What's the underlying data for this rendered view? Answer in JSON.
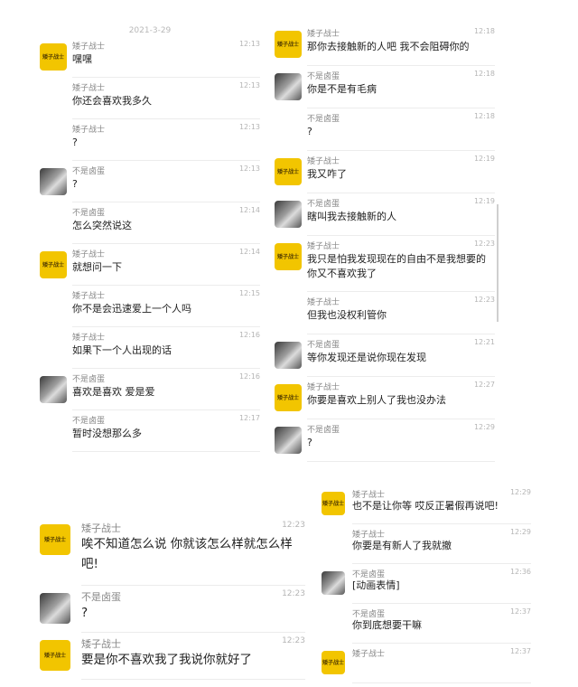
{
  "date_separator": "2021-3-29",
  "sender_a": "矮子战士",
  "sender_b": "不是卤蛋",
  "panel_tl": [
    {
      "who": "a",
      "avatar": "yellow-avatar",
      "time": "12:13",
      "text": "嘿嘿"
    },
    {
      "who": "a",
      "avatar": "",
      "time": "12:13",
      "text": "你还会喜欢我多久"
    },
    {
      "who": "a",
      "avatar": "",
      "time": "12:13",
      "text": "?"
    },
    {
      "who": "b",
      "avatar": "photo-avatar",
      "time": "12:13",
      "text": "?"
    },
    {
      "who": "b",
      "avatar": "",
      "time": "12:14",
      "text": "怎么突然说这"
    },
    {
      "who": "a",
      "avatar": "yellow-avatar",
      "time": "12:14",
      "text": "就想问一下"
    },
    {
      "who": "a",
      "avatar": "",
      "time": "12:15",
      "text": "你不是会迅速爱上一个人吗"
    },
    {
      "who": "a",
      "avatar": "",
      "time": "12:16",
      "text": "如果下一个人出现的话"
    },
    {
      "who": "b",
      "avatar": "photo-avatar",
      "time": "12:16",
      "text": "喜欢是喜欢 爱是爱"
    },
    {
      "who": "b",
      "avatar": "",
      "time": "12:17",
      "text": "暂时没想那么多"
    }
  ],
  "panel_tr": [
    {
      "who": "a",
      "avatar": "yellow-avatar",
      "time": "12:18",
      "text": "那你去接触新的人吧 我不会阻碍你的"
    },
    {
      "who": "b",
      "avatar": "photo-avatar",
      "time": "12:18",
      "text": "你是不是有毛病"
    },
    {
      "who": "b",
      "avatar": "",
      "time": "12:18",
      "text": "?"
    },
    {
      "who": "a",
      "avatar": "yellow-avatar",
      "time": "12:19",
      "text": "我又咋了"
    },
    {
      "who": "b",
      "avatar": "photo-avatar",
      "time": "12:19",
      "text": "瞎叫我去接触新的人"
    },
    {
      "who": "a",
      "avatar": "yellow-avatar",
      "time": "12:23",
      "text": "我只是怕我发现现在的自由不是我想要的 你又不喜欢我了"
    },
    {
      "who": "a",
      "avatar": "",
      "time": "12:23",
      "text": "但我也没权利管你"
    },
    {
      "who": "b",
      "avatar": "photo-avatar",
      "time": "12:21",
      "text": "等你发现还是说你现在发现"
    },
    {
      "who": "a",
      "avatar": "yellow-avatar",
      "time": "12:27",
      "text": "你要是喜欢上别人了我也没办法"
    },
    {
      "who": "b",
      "avatar": "photo-avatar",
      "time": "12:29",
      "text": "?"
    }
  ],
  "panel_bl": [
    {
      "who": "a",
      "avatar": "yellow-avatar",
      "time": "12:23",
      "text": "唉不知道怎么说 你就该怎么样就怎么样吧!"
    },
    {
      "who": "b",
      "avatar": "photo-avatar",
      "time": "12:23",
      "text": "?"
    },
    {
      "who": "a",
      "avatar": "yellow-avatar",
      "time": "12:23",
      "text": "要是你不喜欢我了我说你就好了"
    }
  ],
  "panel_br": [
    {
      "who": "a",
      "avatar": "yellow-avatar",
      "time": "12:29",
      "text": "也不是让你等 哎反正暑假再说吧!"
    },
    {
      "who": "a",
      "avatar": "",
      "time": "12:29",
      "text": "你要是有新人了我就撤"
    },
    {
      "who": "b",
      "avatar": "photo-avatar",
      "time": "12:36",
      "text": "[动画表情]"
    },
    {
      "who": "b",
      "avatar": "",
      "time": "12:37",
      "text": "你到底想要干嘛"
    },
    {
      "who": "a",
      "avatar": "yellow-avatar",
      "time": "12:37",
      "text": ""
    }
  ],
  "avatar_yellow_text": "矮子战士"
}
